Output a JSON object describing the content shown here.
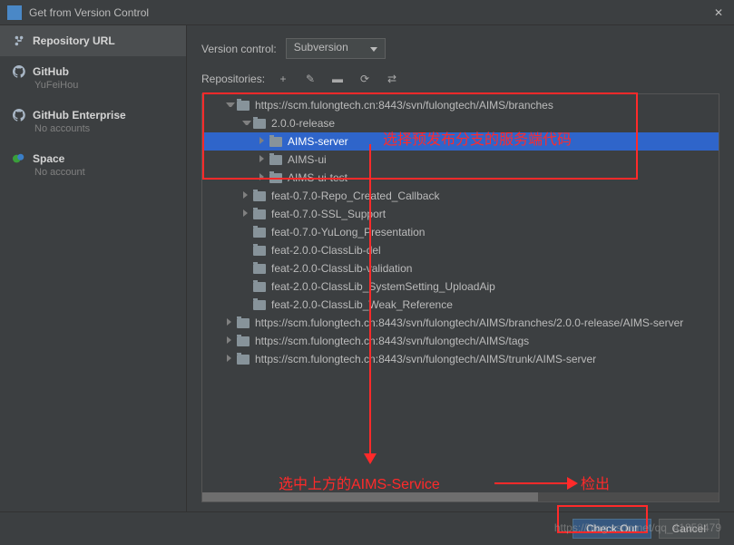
{
  "window": {
    "title": "Get from Version Control"
  },
  "sidebar": {
    "items": [
      {
        "label": "Repository URL",
        "sub": ""
      },
      {
        "label": "GitHub",
        "sub": "YuFeiHou"
      },
      {
        "label": "GitHub Enterprise",
        "sub": "No accounts"
      },
      {
        "label": "Space",
        "sub": "No account"
      }
    ]
  },
  "vc": {
    "label": "Version control:",
    "value": "Subversion"
  },
  "repos": {
    "label": "Repositories:"
  },
  "tree": [
    {
      "d": 1,
      "t": "https://scm.fulongtech.cn:8443/svn/fulongtech/AIMS/branches",
      "s": "expanded"
    },
    {
      "d": 2,
      "t": "2.0.0-release",
      "s": "expanded"
    },
    {
      "d": 3,
      "t": "AIMS-server",
      "s": "collapsed",
      "sel": true
    },
    {
      "d": 3,
      "t": "AIMS-ui",
      "s": "collapsed"
    },
    {
      "d": 3,
      "t": "AIMS-ui-test",
      "s": "collapsed"
    },
    {
      "d": 2,
      "t": "feat-0.7.0-Repo_Created_Callback",
      "s": "collapsed"
    },
    {
      "d": 2,
      "t": "feat-0.7.0-SSL_Support",
      "s": "collapsed"
    },
    {
      "d": 2,
      "t": "feat-0.7.0-YuLong_Presentation",
      "s": ""
    },
    {
      "d": 2,
      "t": "feat-2.0.0-ClassLib-del",
      "s": ""
    },
    {
      "d": 2,
      "t": "feat-2.0.0-ClassLib-validation",
      "s": ""
    },
    {
      "d": 2,
      "t": "feat-2.0.0-ClassLib_SystemSetting_UploadAip",
      "s": ""
    },
    {
      "d": 2,
      "t": "feat-2.0.0-ClassLib_Weak_Reference",
      "s": ""
    },
    {
      "d": 1,
      "t": "https://scm.fulongtech.cn:8443/svn/fulongtech/AIMS/branches/2.0.0-release/AIMS-server",
      "s": "collapsed"
    },
    {
      "d": 1,
      "t": "https://scm.fulongtech.cn:8443/svn/fulongtech/AIMS/tags",
      "s": "collapsed"
    },
    {
      "d": 1,
      "t": "https://scm.fulongtech.cn:8443/svn/fulongtech/AIMS/trunk/AIMS-server",
      "s": "collapsed"
    }
  ],
  "annotations": {
    "a1": "选择预发布分支的服务端代码",
    "a2": "选中上方的AIMS-Service",
    "a3": "检出"
  },
  "buttons": {
    "checkout": "Check Out",
    "cancel": "Cancel"
  },
  "watermark": "https://blog.csdn.net/qq_41858479"
}
